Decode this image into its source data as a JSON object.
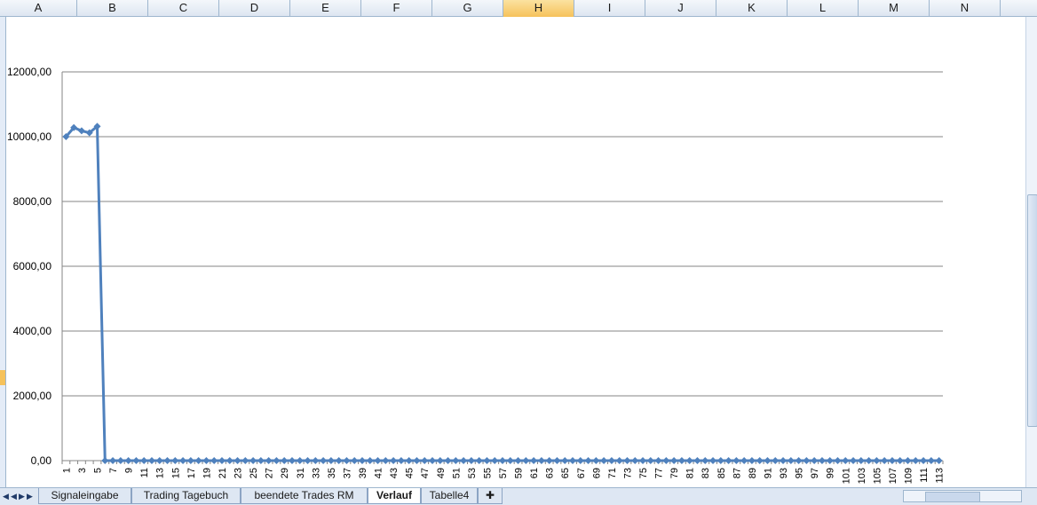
{
  "columns": [
    "A",
    "B",
    "C",
    "D",
    "E",
    "F",
    "G",
    "H",
    "I",
    "J",
    "K",
    "L",
    "M",
    "N"
  ],
  "active_column": "H",
  "sheet_tabs": [
    {
      "label": "Signaleingabe",
      "active": false
    },
    {
      "label": "Trading Tagebuch",
      "active": false
    },
    {
      "label": "beendete Trades RM",
      "active": false
    },
    {
      "label": "Verlauf",
      "active": true
    },
    {
      "label": "Tabelle4",
      "active": false
    }
  ],
  "colors": {
    "series": "#4f81bd",
    "gridline": "#868686",
    "axis": "#868686"
  },
  "icons": {
    "new_sheet": "new-sheet-icon",
    "nav_first": "nav-first-icon",
    "nav_prev": "nav-prev-icon",
    "nav_next": "nav-next-icon",
    "nav_last": "nav-last-icon"
  },
  "chart_data": {
    "type": "line",
    "title": "",
    "xlabel": "",
    "ylabel": "",
    "ylim": [
      0,
      12000
    ],
    "yticks": [
      "0,00",
      "2000,00",
      "4000,00",
      "6000,00",
      "8000,00",
      "10000,00",
      "12000,00"
    ],
    "ytick_values": [
      0,
      2000,
      4000,
      6000,
      8000,
      10000,
      12000
    ],
    "grid": true,
    "legend": "none",
    "marker": "diamond",
    "x_label_step": 2,
    "x": [
      1,
      2,
      3,
      4,
      5,
      6,
      7,
      8,
      9,
      10,
      11,
      12,
      13,
      14,
      15,
      16,
      17,
      18,
      19,
      20,
      21,
      22,
      23,
      24,
      25,
      26,
      27,
      28,
      29,
      30,
      31,
      32,
      33,
      34,
      35,
      36,
      37,
      38,
      39,
      40,
      41,
      42,
      43,
      44,
      45,
      46,
      47,
      48,
      49,
      50,
      51,
      52,
      53,
      54,
      55,
      56,
      57,
      58,
      59,
      60,
      61,
      62,
      63,
      64,
      65,
      66,
      67,
      68,
      69,
      70,
      71,
      72,
      73,
      74,
      75,
      76,
      77,
      78,
      79,
      80,
      81,
      82,
      83,
      84,
      85,
      86,
      87,
      88,
      89,
      90,
      91,
      92,
      93,
      94,
      95,
      96,
      97,
      98,
      99,
      100,
      101,
      102,
      103,
      104,
      105,
      106,
      107,
      108,
      109,
      110,
      111,
      112,
      113
    ],
    "values": [
      10000,
      10280,
      10180,
      10120,
      10320,
      0,
      0,
      0,
      0,
      0,
      0,
      0,
      0,
      0,
      0,
      0,
      0,
      0,
      0,
      0,
      0,
      0,
      0,
      0,
      0,
      0,
      0,
      0,
      0,
      0,
      0,
      0,
      0,
      0,
      0,
      0,
      0,
      0,
      0,
      0,
      0,
      0,
      0,
      0,
      0,
      0,
      0,
      0,
      0,
      0,
      0,
      0,
      0,
      0,
      0,
      0,
      0,
      0,
      0,
      0,
      0,
      0,
      0,
      0,
      0,
      0,
      0,
      0,
      0,
      0,
      0,
      0,
      0,
      0,
      0,
      0,
      0,
      0,
      0,
      0,
      0,
      0,
      0,
      0,
      0,
      0,
      0,
      0,
      0,
      0,
      0,
      0,
      0,
      0,
      0,
      0,
      0,
      0,
      0,
      0,
      0,
      0,
      0,
      0,
      0,
      0,
      0,
      0,
      0,
      0,
      0,
      0,
      0
    ]
  }
}
